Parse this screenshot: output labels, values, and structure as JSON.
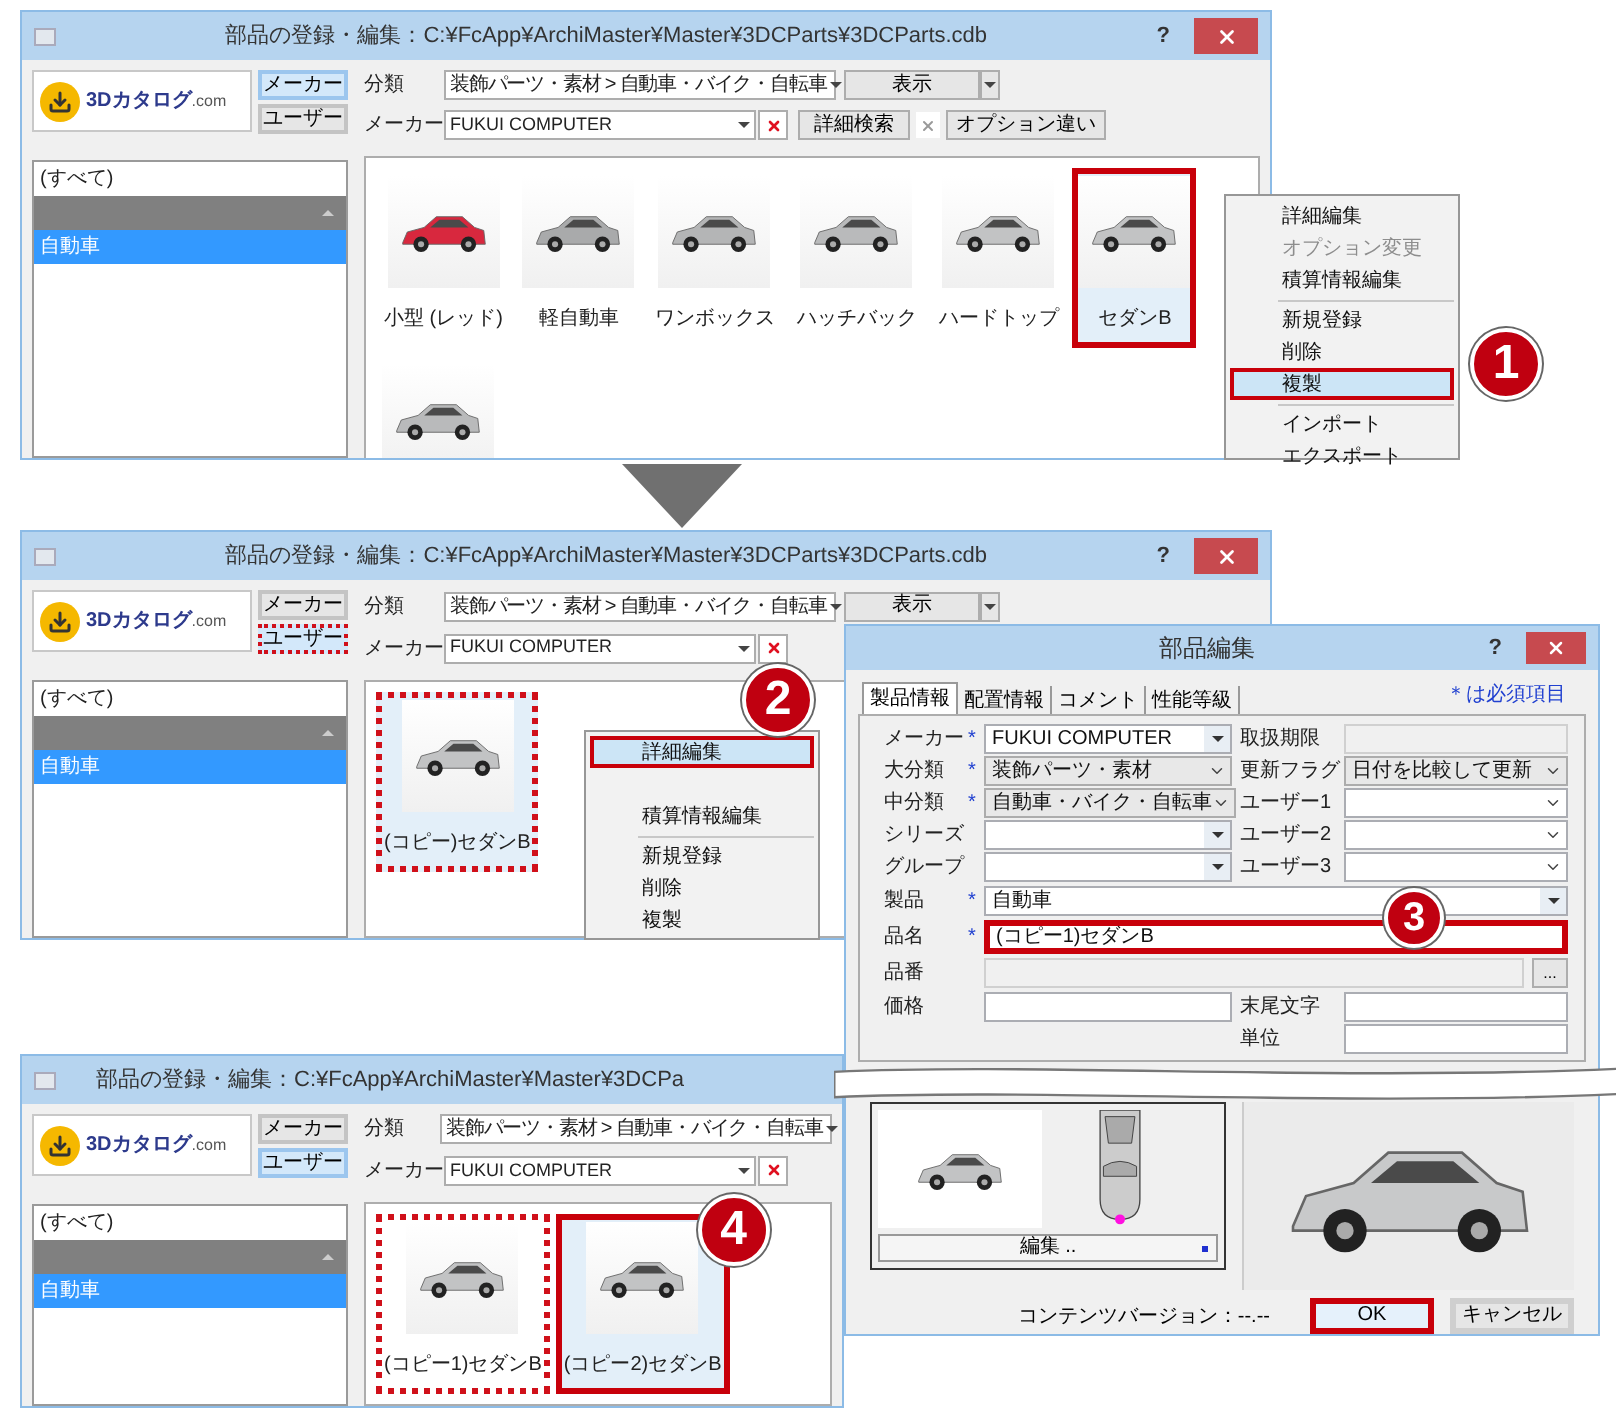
{
  "windows": [
    {
      "title": "部品の登録・編集：C:¥FcApp¥ArchiMaster¥Master¥3DCParts¥3DCParts.cdb",
      "help": "?",
      "close_button": true,
      "logo": {
        "text": "3Dカタログ",
        "suffix": ".com"
      },
      "source_buttons": [
        {
          "label": "メーカー",
          "selected": true
        },
        {
          "label": "ユーザー",
          "selected": false
        }
      ],
      "category": {
        "label": "分類",
        "value": "装飾パーツ・素材 > 自動車・バイク・自転車"
      },
      "view_button": "表示",
      "maker": {
        "label": "メーカー",
        "value": "FUKUI COMPUTER"
      },
      "detail_search": "詳細検索",
      "option_button": "オプション違い",
      "list": [
        {
          "kind": "item",
          "label": "(すべて)",
          "selected": false
        },
        {
          "kind": "header",
          "selected": false
        },
        {
          "kind": "item",
          "label": "自動車",
          "selected": true
        }
      ],
      "parts": [
        {
          "label": "小型 (レッド)",
          "color": "#d8283e",
          "selected": false,
          "red_frame": false
        },
        {
          "label": "軽自動車",
          "color": "#a9aaab",
          "selected": false,
          "red_frame": false
        },
        {
          "label": "ワンボックス",
          "color": "#b4b5b6",
          "selected": false,
          "red_frame": false
        },
        {
          "label": "ハッチバック",
          "color": "#b9babb",
          "selected": false,
          "red_frame": false
        },
        {
          "label": "ハードトップ",
          "color": "#c2c3c4",
          "selected": false,
          "red_frame": false
        },
        {
          "label": "セダンB",
          "color": "#c2c3c4",
          "selected": true,
          "red_frame": true
        },
        {
          "color": "#b9babb",
          "selected": false,
          "red_frame": false
        }
      ],
      "context_menu": [
        {
          "kind": "item",
          "label": "詳細編集",
          "disabled": false,
          "selected": false,
          "separator_before": false,
          "red_frame": false
        },
        {
          "kind": "item",
          "label": "オプション変更",
          "disabled": true,
          "selected": false,
          "separator_before": false,
          "red_frame": false
        },
        {
          "kind": "item",
          "label": "積算情報編集",
          "disabled": false,
          "selected": false,
          "separator_before": false,
          "red_frame": false
        },
        {
          "kind": "item",
          "label": "新規登録",
          "disabled": false,
          "selected": false,
          "separator_before": true,
          "red_frame": false
        },
        {
          "kind": "item",
          "label": "削除",
          "disabled": false,
          "selected": false,
          "separator_before": false,
          "red_frame": false
        },
        {
          "kind": "item",
          "label": "複製",
          "disabled": false,
          "selected": true,
          "separator_before": false,
          "red_frame": true,
          "callout": "1"
        },
        {
          "kind": "item",
          "label": "インポート",
          "disabled": false,
          "selected": false,
          "separator_before": true,
          "red_frame": false
        },
        {
          "kind": "item",
          "label": "エクスポート",
          "disabled": false,
          "selected": false,
          "separator_before": false,
          "red_frame": false
        }
      ]
    },
    {
      "title": "部品の登録・編集：C:¥FcApp¥ArchiMaster¥Master¥3DCParts¥3DCParts.cdb",
      "help": "?",
      "close_button": true,
      "logo": {
        "text": "3Dカタログ",
        "suffix": ".com"
      },
      "source_buttons": [
        {
          "label": "メーカー",
          "selected": false,
          "dotted_frame": false
        },
        {
          "label": "ユーザー",
          "selected": true,
          "dotted_frame": true
        }
      ],
      "category": {
        "label": "分類",
        "value": "装飾パーツ・素材 > 自動車・バイク・自転車"
      },
      "view_button": "表示",
      "maker": {
        "label": "メーカー",
        "value": "FUKUI COMPUTER"
      },
      "list": [
        {
          "kind": "item",
          "label": "(すべて)",
          "selected": false
        },
        {
          "kind": "header",
          "selected": false
        },
        {
          "kind": "item",
          "label": "自動車",
          "selected": true
        }
      ],
      "parts": [
        {
          "label": "(コピー)セダンB",
          "color": "#c2c3c4",
          "selected": true,
          "dotted_frame": true
        }
      ],
      "context_menu": [
        {
          "kind": "item",
          "label": "詳細編集",
          "disabled": false,
          "selected": true,
          "separator_before": false,
          "red_frame": true,
          "callout": "2"
        },
        {
          "kind": "blank"
        },
        {
          "kind": "item",
          "label": "積算情報編集",
          "disabled": false,
          "selected": false,
          "separator_before": false,
          "red_frame": false
        },
        {
          "kind": "item",
          "label": "新規登録",
          "disabled": false,
          "selected": false,
          "separator_before": true,
          "red_frame": false
        },
        {
          "kind": "item",
          "label": "削除",
          "disabled": false,
          "selected": false,
          "separator_before": false,
          "red_frame": false
        },
        {
          "kind": "item",
          "label": "複製",
          "disabled": false,
          "selected": false,
          "separator_before": false,
          "red_frame": false
        }
      ]
    },
    {
      "title": "部品の登録・編集：C:¥FcApp¥ArchiMaster¥Master¥3DCPa",
      "logo": {
        "text": "3Dカタログ",
        "suffix": ".com"
      },
      "source_buttons": [
        {
          "label": "メーカー",
          "selected": false
        },
        {
          "label": "ユーザー",
          "selected": true
        }
      ],
      "category": {
        "label": "分類",
        "value": "装飾パーツ・素材 > 自動車・バイク・自転車"
      },
      "maker": {
        "label": "メーカー",
        "value": "FUKUI COMPUTER"
      },
      "list": [
        {
          "kind": "item",
          "label": "(すべて)",
          "selected": false
        },
        {
          "kind": "header",
          "selected": false
        },
        {
          "kind": "item",
          "label": "自動車",
          "selected": true
        }
      ],
      "parts": [
        {
          "label": "(コピー1)セダンB",
          "color": "#c2c3c4",
          "selected": false,
          "dotted_frame": true
        },
        {
          "label": "(コピー2)セダンB",
          "color": "#c2c3c4",
          "selected": true,
          "red_frame": true,
          "callout": "4"
        }
      ]
    }
  ],
  "dialog": {
    "title": "部品編集",
    "help": "?",
    "tabs": [
      {
        "label": "製品情報",
        "selected": true
      },
      {
        "label": "配置情報",
        "selected": false
      },
      {
        "label": "コメント",
        "selected": false
      },
      {
        "label": "性能等級",
        "selected": false
      }
    ],
    "required_note": "＊は必須項目",
    "rows": [
      {
        "kind": "pair",
        "left": {
          "label": "メーカー",
          "mark": "*",
          "kind": "combo",
          "value": "FUKUI COMPUTER"
        },
        "right": {
          "label": "取扱期限",
          "kind": "readonly"
        }
      },
      {
        "kind": "pair",
        "left": {
          "label": "大分類",
          "mark": "*",
          "kind": "list",
          "value": "装飾パーツ・素材"
        },
        "right": {
          "label": "更新フラグ",
          "kind": "list",
          "value": "日付を比較して更新"
        }
      },
      {
        "kind": "pair",
        "left": {
          "label": "中分類",
          "mark": "*",
          "kind": "list",
          "value": "自動車・バイク・自転車"
        },
        "right": {
          "label": "ユーザー1",
          "kind": "select"
        }
      },
      {
        "kind": "pair",
        "left": {
          "label": "シリーズ",
          "kind": "combo"
        },
        "right": {
          "label": "ユーザー2",
          "kind": "select"
        }
      },
      {
        "kind": "pair",
        "left": {
          "label": "グループ",
          "kind": "combo"
        },
        "right": {
          "label": "ユーザー3",
          "kind": "select"
        }
      },
      {
        "kind": "wide",
        "field": {
          "label": "製品",
          "mark": "*",
          "kind": "combo",
          "value": "自動車"
        }
      },
      {
        "kind": "wide",
        "field": {
          "label": "品名",
          "mark": "*",
          "kind": "text",
          "value": "(コピー1)セダンB",
          "red_frame": true,
          "callout": "3"
        }
      },
      {
        "kind": "wide",
        "field": {
          "label": "品番",
          "kind": "readonly",
          "browse": "..."
        }
      },
      {
        "kind": "pair",
        "left": {
          "label": "価格",
          "kind": "text"
        },
        "right": {
          "label": "末尾文字",
          "kind": "text"
        }
      },
      {
        "kind": "pair",
        "right": {
          "label": "単位",
          "kind": "text"
        }
      }
    ],
    "edit_button": "編集 ..",
    "version_label": "コンテンツバージョン：",
    "version": "--.--",
    "buttons": [
      {
        "label": "OK",
        "default": true,
        "red_frame": true
      },
      {
        "label": "キャンセル",
        "default": false,
        "red_frame": false
      }
    ]
  }
}
